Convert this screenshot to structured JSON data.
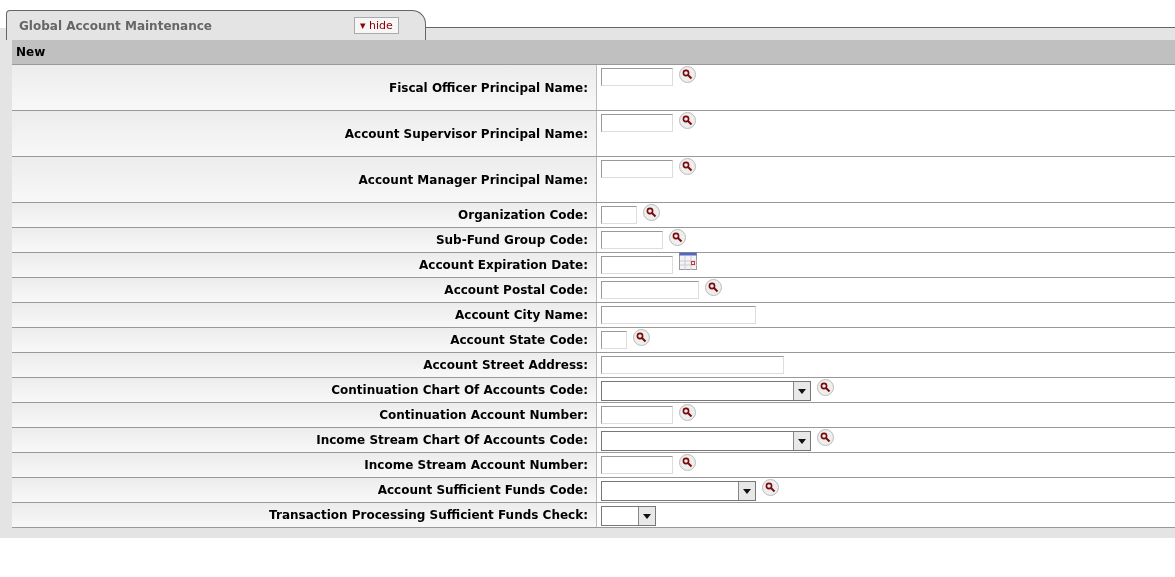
{
  "tab": {
    "title": "Global Account Maintenance",
    "toggle": {
      "icon": "▾",
      "label": "hide"
    }
  },
  "section": {
    "title": "New"
  },
  "rows": [
    {
      "label": "Fiscal Officer Principal Name:",
      "kind": "text",
      "lookup": true
    },
    {
      "label": "Account Supervisor Principal Name:",
      "kind": "text",
      "lookup": true
    },
    {
      "label": "Account Manager Principal Name:",
      "kind": "text",
      "lookup": true
    },
    {
      "label": "Organization Code:",
      "kind": "text",
      "lookup": true
    },
    {
      "label": "Sub-Fund Group Code:",
      "kind": "text",
      "lookup": true
    },
    {
      "label": "Account Expiration Date:",
      "kind": "date",
      "lookup": false
    },
    {
      "label": "Account Postal Code:",
      "kind": "text",
      "lookup": true
    },
    {
      "label": "Account City Name:",
      "kind": "text",
      "lookup": false
    },
    {
      "label": "Account State Code:",
      "kind": "text",
      "lookup": true
    },
    {
      "label": "Account Street Address:",
      "kind": "text",
      "lookup": false
    },
    {
      "label": "Continuation Chart Of Accounts Code:",
      "kind": "select",
      "lookup": true
    },
    {
      "label": "Continuation Account Number:",
      "kind": "text",
      "lookup": true
    },
    {
      "label": "Income Stream Chart Of Accounts Code:",
      "kind": "select",
      "lookup": true
    },
    {
      "label": "Income Stream Account Number:",
      "kind": "text",
      "lookup": true
    },
    {
      "label": "Account Sufficient Funds Code:",
      "kind": "select",
      "lookup": true
    },
    {
      "label": "Transaction Processing Sufficient Funds Check:",
      "kind": "select",
      "lookup": false
    }
  ]
}
